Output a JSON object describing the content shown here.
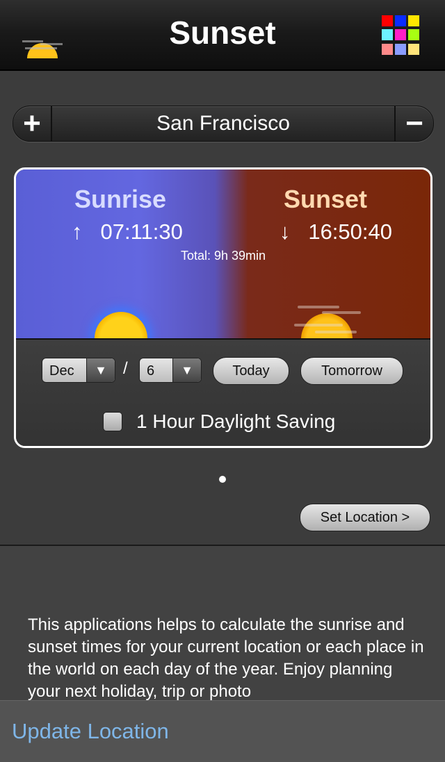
{
  "header": {
    "title": "Sunset",
    "logo_icon": "setting-sun-icon",
    "grid_icon": "color-grid-icon",
    "grid_colors": [
      "#ff0000",
      "#0a2bff",
      "#ffe600",
      "#6ef2ff",
      "#ff1fc8",
      "#a8ff12",
      "#ff8a8a",
      "#8a9cff",
      "#ffe47a"
    ]
  },
  "location": {
    "add_label": "+",
    "city": "San Francisco",
    "remove_label": "−"
  },
  "sun_times": {
    "sunrise_label": "Sunrise",
    "sunrise_arrow": "↑",
    "sunrise_time": "07:11:30",
    "sunset_label": "Sunset",
    "sunset_arrow": "↓",
    "sunset_time": "16:50:40",
    "total": "Total: 9h 39min"
  },
  "controls": {
    "month": "Dec",
    "separator": "/",
    "day": "6",
    "dropdown_arrow": "▼",
    "today_label": "Today",
    "tomorrow_label": "Tomorrow",
    "daylight_saving_label": "1 Hour Daylight Saving",
    "daylight_saving_checked": false
  },
  "set_location_label": "Set Location >",
  "description": "This applications helps to calculate the sunrise and sunset times for your current location or each place in the world on each day of the year. Enjoy planning your next holiday, trip or photo",
  "bottom_bar": {
    "update_location_label": "Update Location"
  }
}
